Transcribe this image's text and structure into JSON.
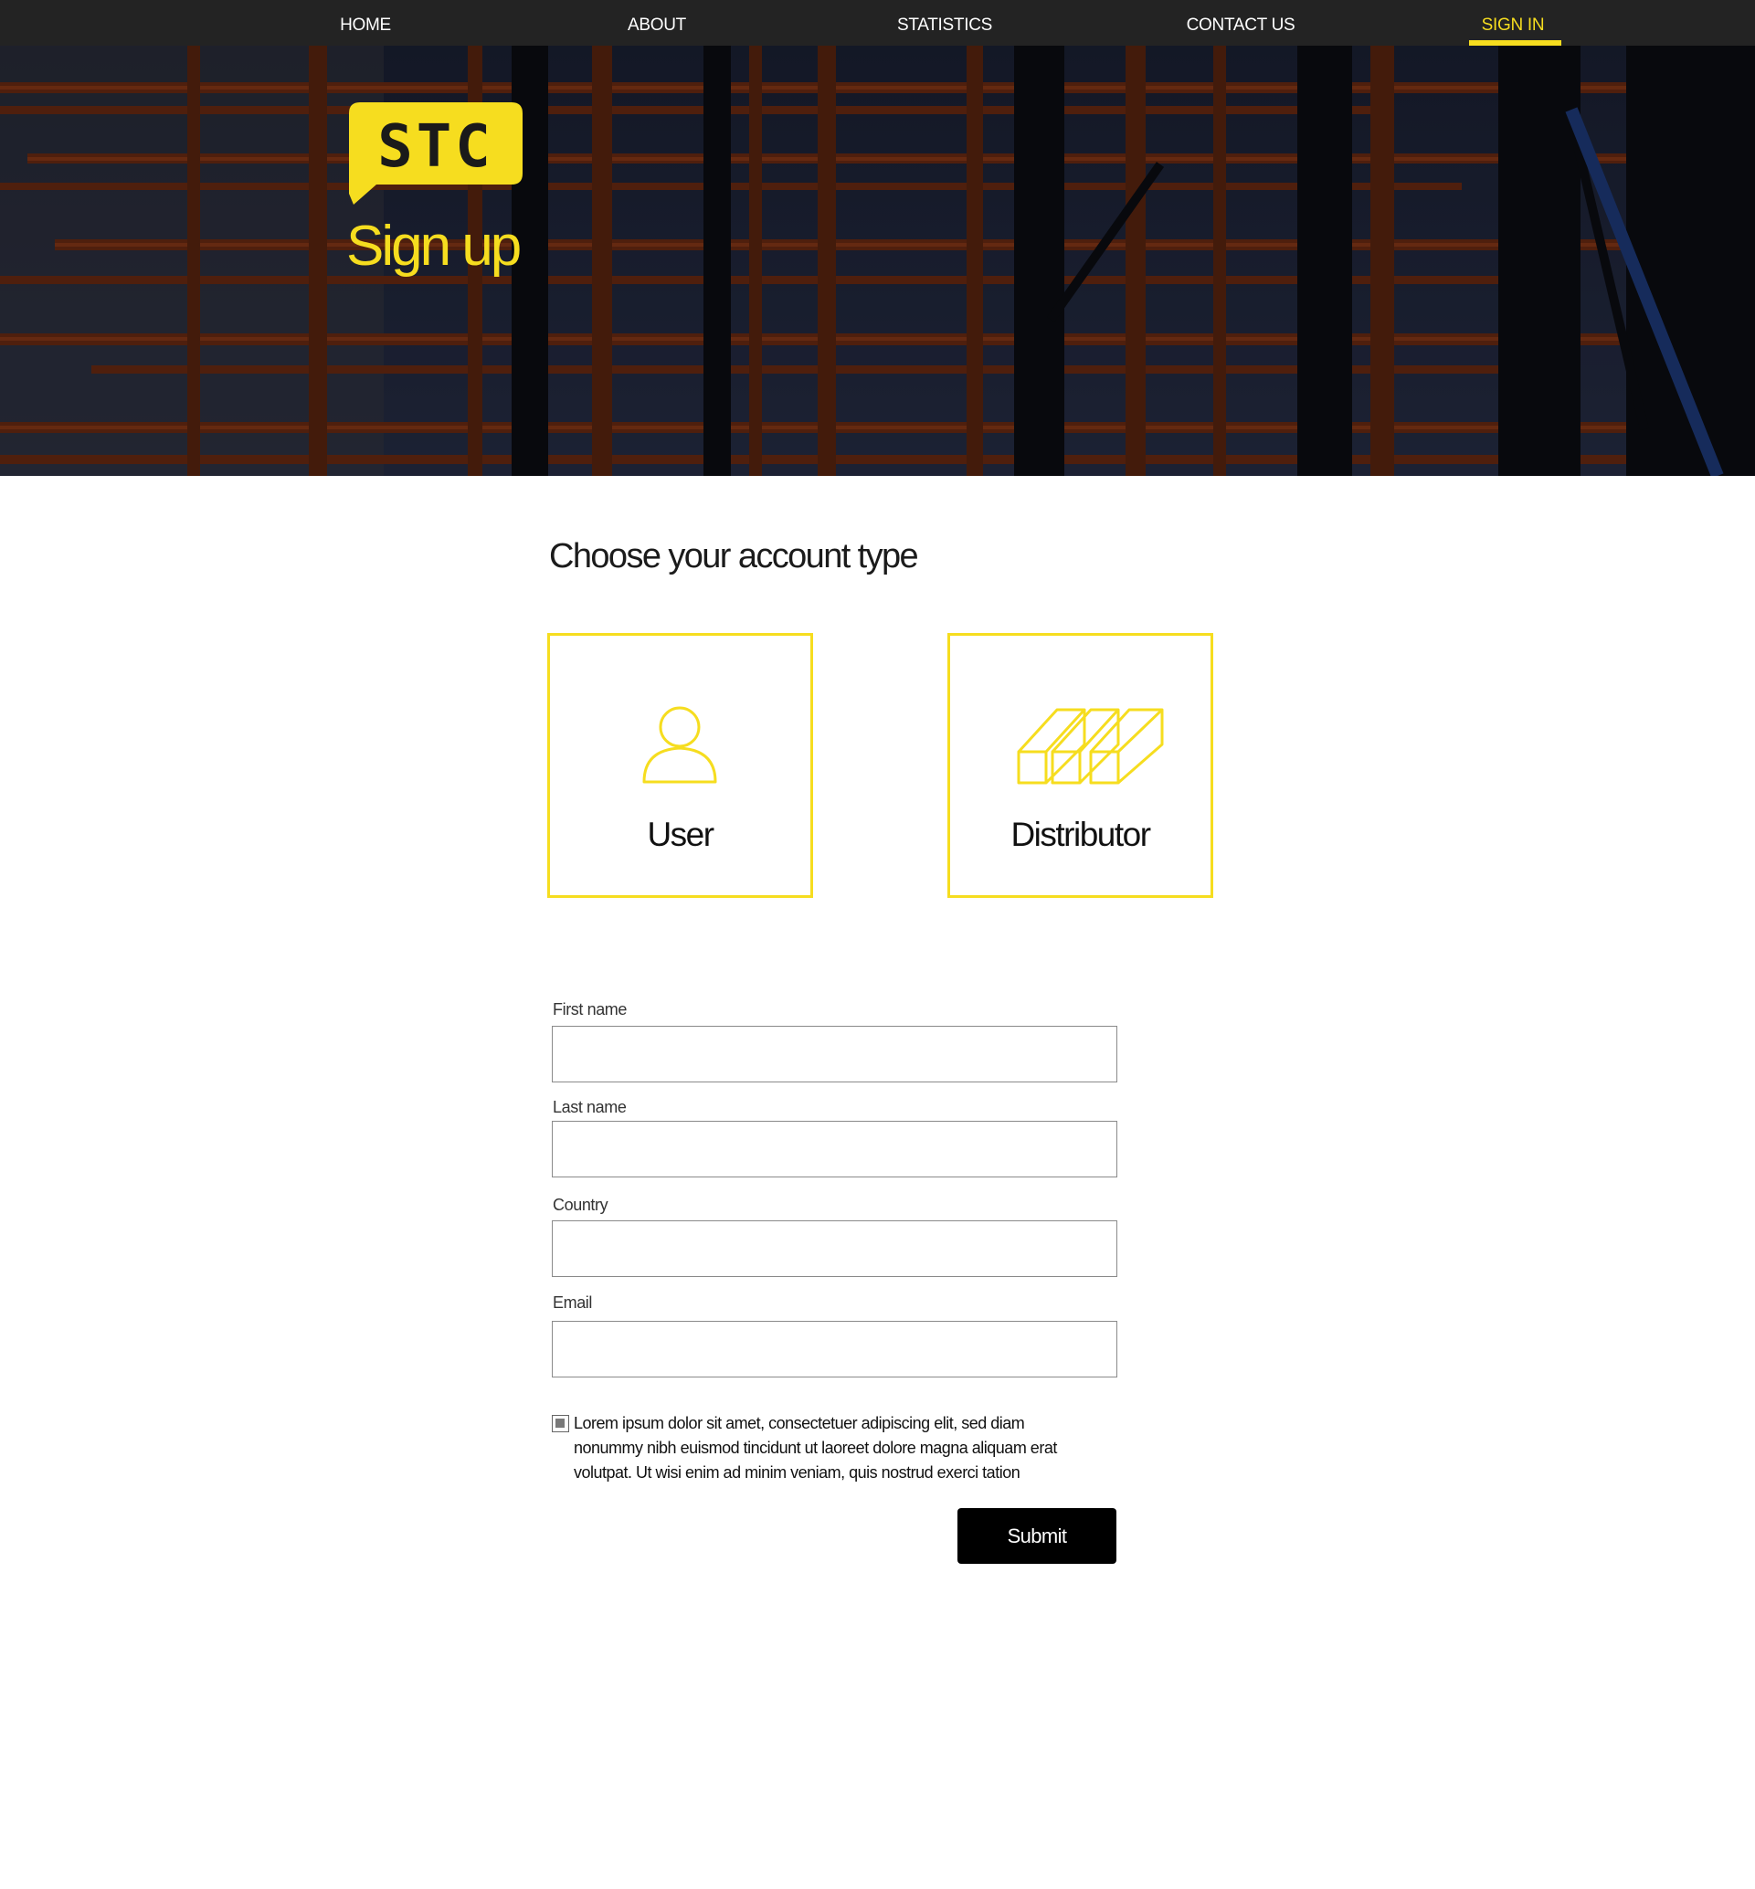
{
  "nav": {
    "items": [
      {
        "label": "HOME"
      },
      {
        "label": "ABOUT"
      },
      {
        "label": "STATISTICS"
      },
      {
        "label": "CONTACT US"
      },
      {
        "label": "SIGN IN",
        "active": true
      }
    ]
  },
  "hero": {
    "logo_text": "STC",
    "title": "Sign up"
  },
  "account": {
    "heading": "Choose your account type",
    "options": [
      {
        "label": "User",
        "icon": "user-icon"
      },
      {
        "label": "Distributor",
        "icon": "beams-icon"
      }
    ]
  },
  "form": {
    "fields": [
      {
        "label": "First name",
        "value": ""
      },
      {
        "label": "Last name",
        "value": ""
      },
      {
        "label": "Country",
        "value": ""
      },
      {
        "label": "Email",
        "value": ""
      }
    ],
    "terms_text": "Lorem ipsum dolor sit amet, consectetuer adipiscing elit, sed diam nonummy nibh euismod tincidunt ut laoreet dolore magna aliquam erat volutpat. Ut wisi enim ad minim veniam, quis nostrud exerci tation",
    "terms_checked": true,
    "submit_label": "Submit"
  },
  "colors": {
    "accent": "#f6dd1f",
    "nav_bg": "#232323",
    "button_bg": "#000000"
  }
}
